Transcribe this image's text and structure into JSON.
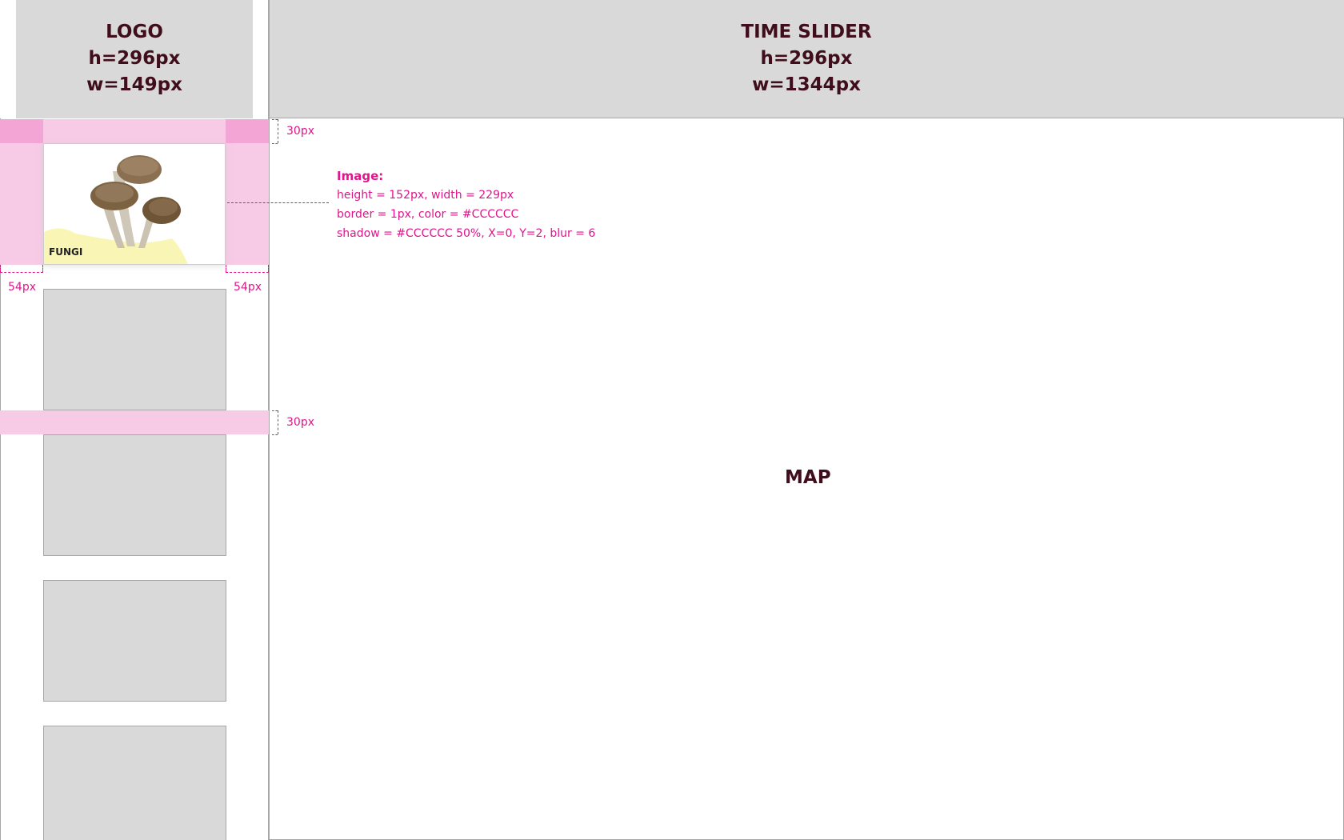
{
  "logo_panel": {
    "title": "LOGO",
    "height_text": "h=296px",
    "width_text": "w=149px"
  },
  "time_slider_panel": {
    "title": "TIME SLIDER",
    "height_text": "h=296px",
    "width_text": "w=1344px"
  },
  "map_panel": {
    "title": "MAP"
  },
  "category_card": {
    "label": "FUNGI",
    "image_icon": "mushroom-icon"
  },
  "annotations": {
    "top_padding": "30px",
    "row_gap": "30px",
    "left_margin": "54px",
    "right_margin": "54px",
    "image_spec": {
      "title": "Image:",
      "size": "height = 152px, width = 229px",
      "border": "border = 1px, color = #CCCCCC",
      "shadow": "shadow = #CCCCCC 50%, X=0, Y=2, blur = 6"
    }
  },
  "colors": {
    "panel_gray": "#d9d9d9",
    "label_dark": "#3f0d1c",
    "annotation_pink": "#e0158c",
    "spacing_pink_light": "#f7cbe6",
    "spacing_pink_dark": "#f3a6d6",
    "fungi_ground": "#f9f6b5"
  }
}
